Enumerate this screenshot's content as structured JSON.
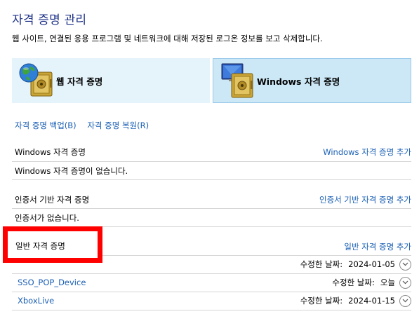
{
  "header": {
    "title": "자격 증명 관리",
    "description": "웹 사이트, 연결된 응용 프로그램 및 네트워크에 대해 저장된 로그온 정보를 보고 삭제합니다."
  },
  "categories": {
    "web": {
      "label": "웹 자격 증명",
      "icon": "web-credential-icon"
    },
    "windows": {
      "label": "Windows 자격 증명",
      "icon": "windows-credential-icon",
      "selected": true
    }
  },
  "actions": {
    "backup": "자격 증명 백업(B)",
    "restore": "자격 증명 복원(R)"
  },
  "sections": {
    "windows": {
      "title": "Windows 자격 증명",
      "add": "Windows 자격 증명 추가",
      "empty": "Windows 자격 증명이 없습니다."
    },
    "certificate": {
      "title": "인증서 기반 자격 증명",
      "add": "인증서 기반 자격 증명 추가",
      "empty": "인증서가 없습니다."
    },
    "generic": {
      "title": "일반 자격 증명",
      "add": "일반 자격 증명 추가",
      "items": [
        {
          "name": "",
          "modified_label": "수정한 날짜:",
          "modified": "2024-01-05"
        },
        {
          "name": "SSO_POP_Device",
          "modified_label": "수정한 날짜:",
          "modified": "오늘"
        },
        {
          "name": "XboxLive",
          "modified_label": "수정한 날짜:",
          "modified": "2024-01-15"
        }
      ]
    }
  },
  "colors": {
    "title": "#1e3287",
    "link": "#1a5fb4",
    "selected_bg": "#cce8f6",
    "highlight": "#ff0000"
  }
}
